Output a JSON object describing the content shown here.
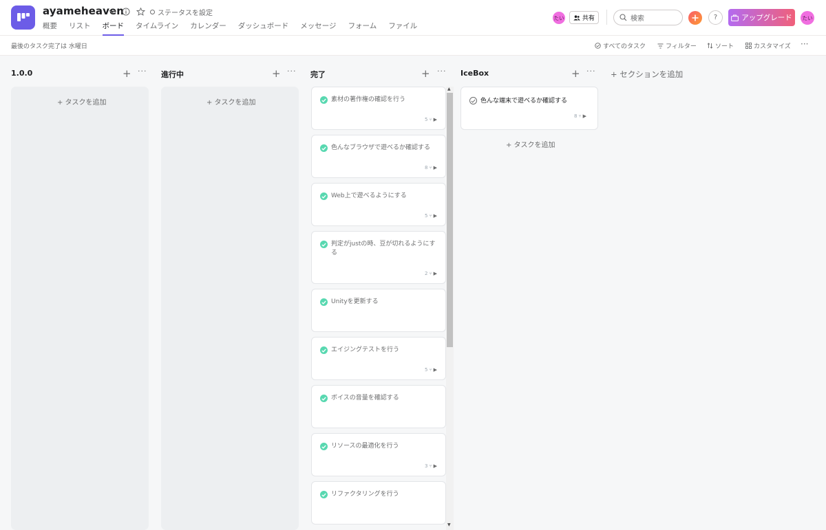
{
  "project": {
    "title": "ayameheaven",
    "status_label": "ステータスを設定"
  },
  "tabs": [
    "概要",
    "リスト",
    "ボード",
    "タイムライン",
    "カレンダー",
    "ダッシュボード",
    "メッセージ",
    "フォーム",
    "ファイル"
  ],
  "active_tab": "ボード",
  "header": {
    "avatar_initials": "たい",
    "share_label": "共有",
    "search_placeholder": "検索",
    "help_label": "?",
    "upgrade_label": "アップグレード",
    "user_avatar_initials": "たい"
  },
  "toolbar": {
    "last_completed": "最後のタスク完了は 水曜日",
    "all_tasks": "すべてのタスク",
    "filter": "フィルター",
    "sort": "ソート",
    "customize": "カスタマイズ",
    "more": "···"
  },
  "columns": [
    {
      "name": "1.0.0",
      "add_task": "+ タスクを追加"
    },
    {
      "name": "進行中",
      "add_task": "+ タスクを追加"
    },
    {
      "name": "完了",
      "add_task": ""
    },
    {
      "name": "IceBox",
      "add_task": "+ タスクを追加"
    }
  ],
  "add_section": "+ セクションを追加",
  "done_tasks": [
    {
      "title": "素材の著作権の確認を行う",
      "subtasks": "5"
    },
    {
      "title": "色んなブラウザで遊べるか確認する",
      "subtasks": "8"
    },
    {
      "title": "Web上で遊べるようにする",
      "subtasks": "5"
    },
    {
      "title": "判定がjustの時、豆が切れるようにする",
      "subtasks": "2"
    },
    {
      "title": "Unityを更新する",
      "subtasks": ""
    },
    {
      "title": "エイジングテストを行う",
      "subtasks": "5"
    },
    {
      "title": "ボイスの音量を確認する",
      "subtasks": ""
    },
    {
      "title": "リソースの最適化を行う",
      "subtasks": "3"
    },
    {
      "title": "リファクタリングを行う",
      "subtasks": ""
    }
  ],
  "icebox_tasks": [
    {
      "title": "色んな端末で遊べるか確認する",
      "subtasks": "8"
    }
  ],
  "colors": {
    "accent": "#6c5ce7",
    "check_done": "#58d8b0",
    "avatar": "#f06ee0"
  }
}
